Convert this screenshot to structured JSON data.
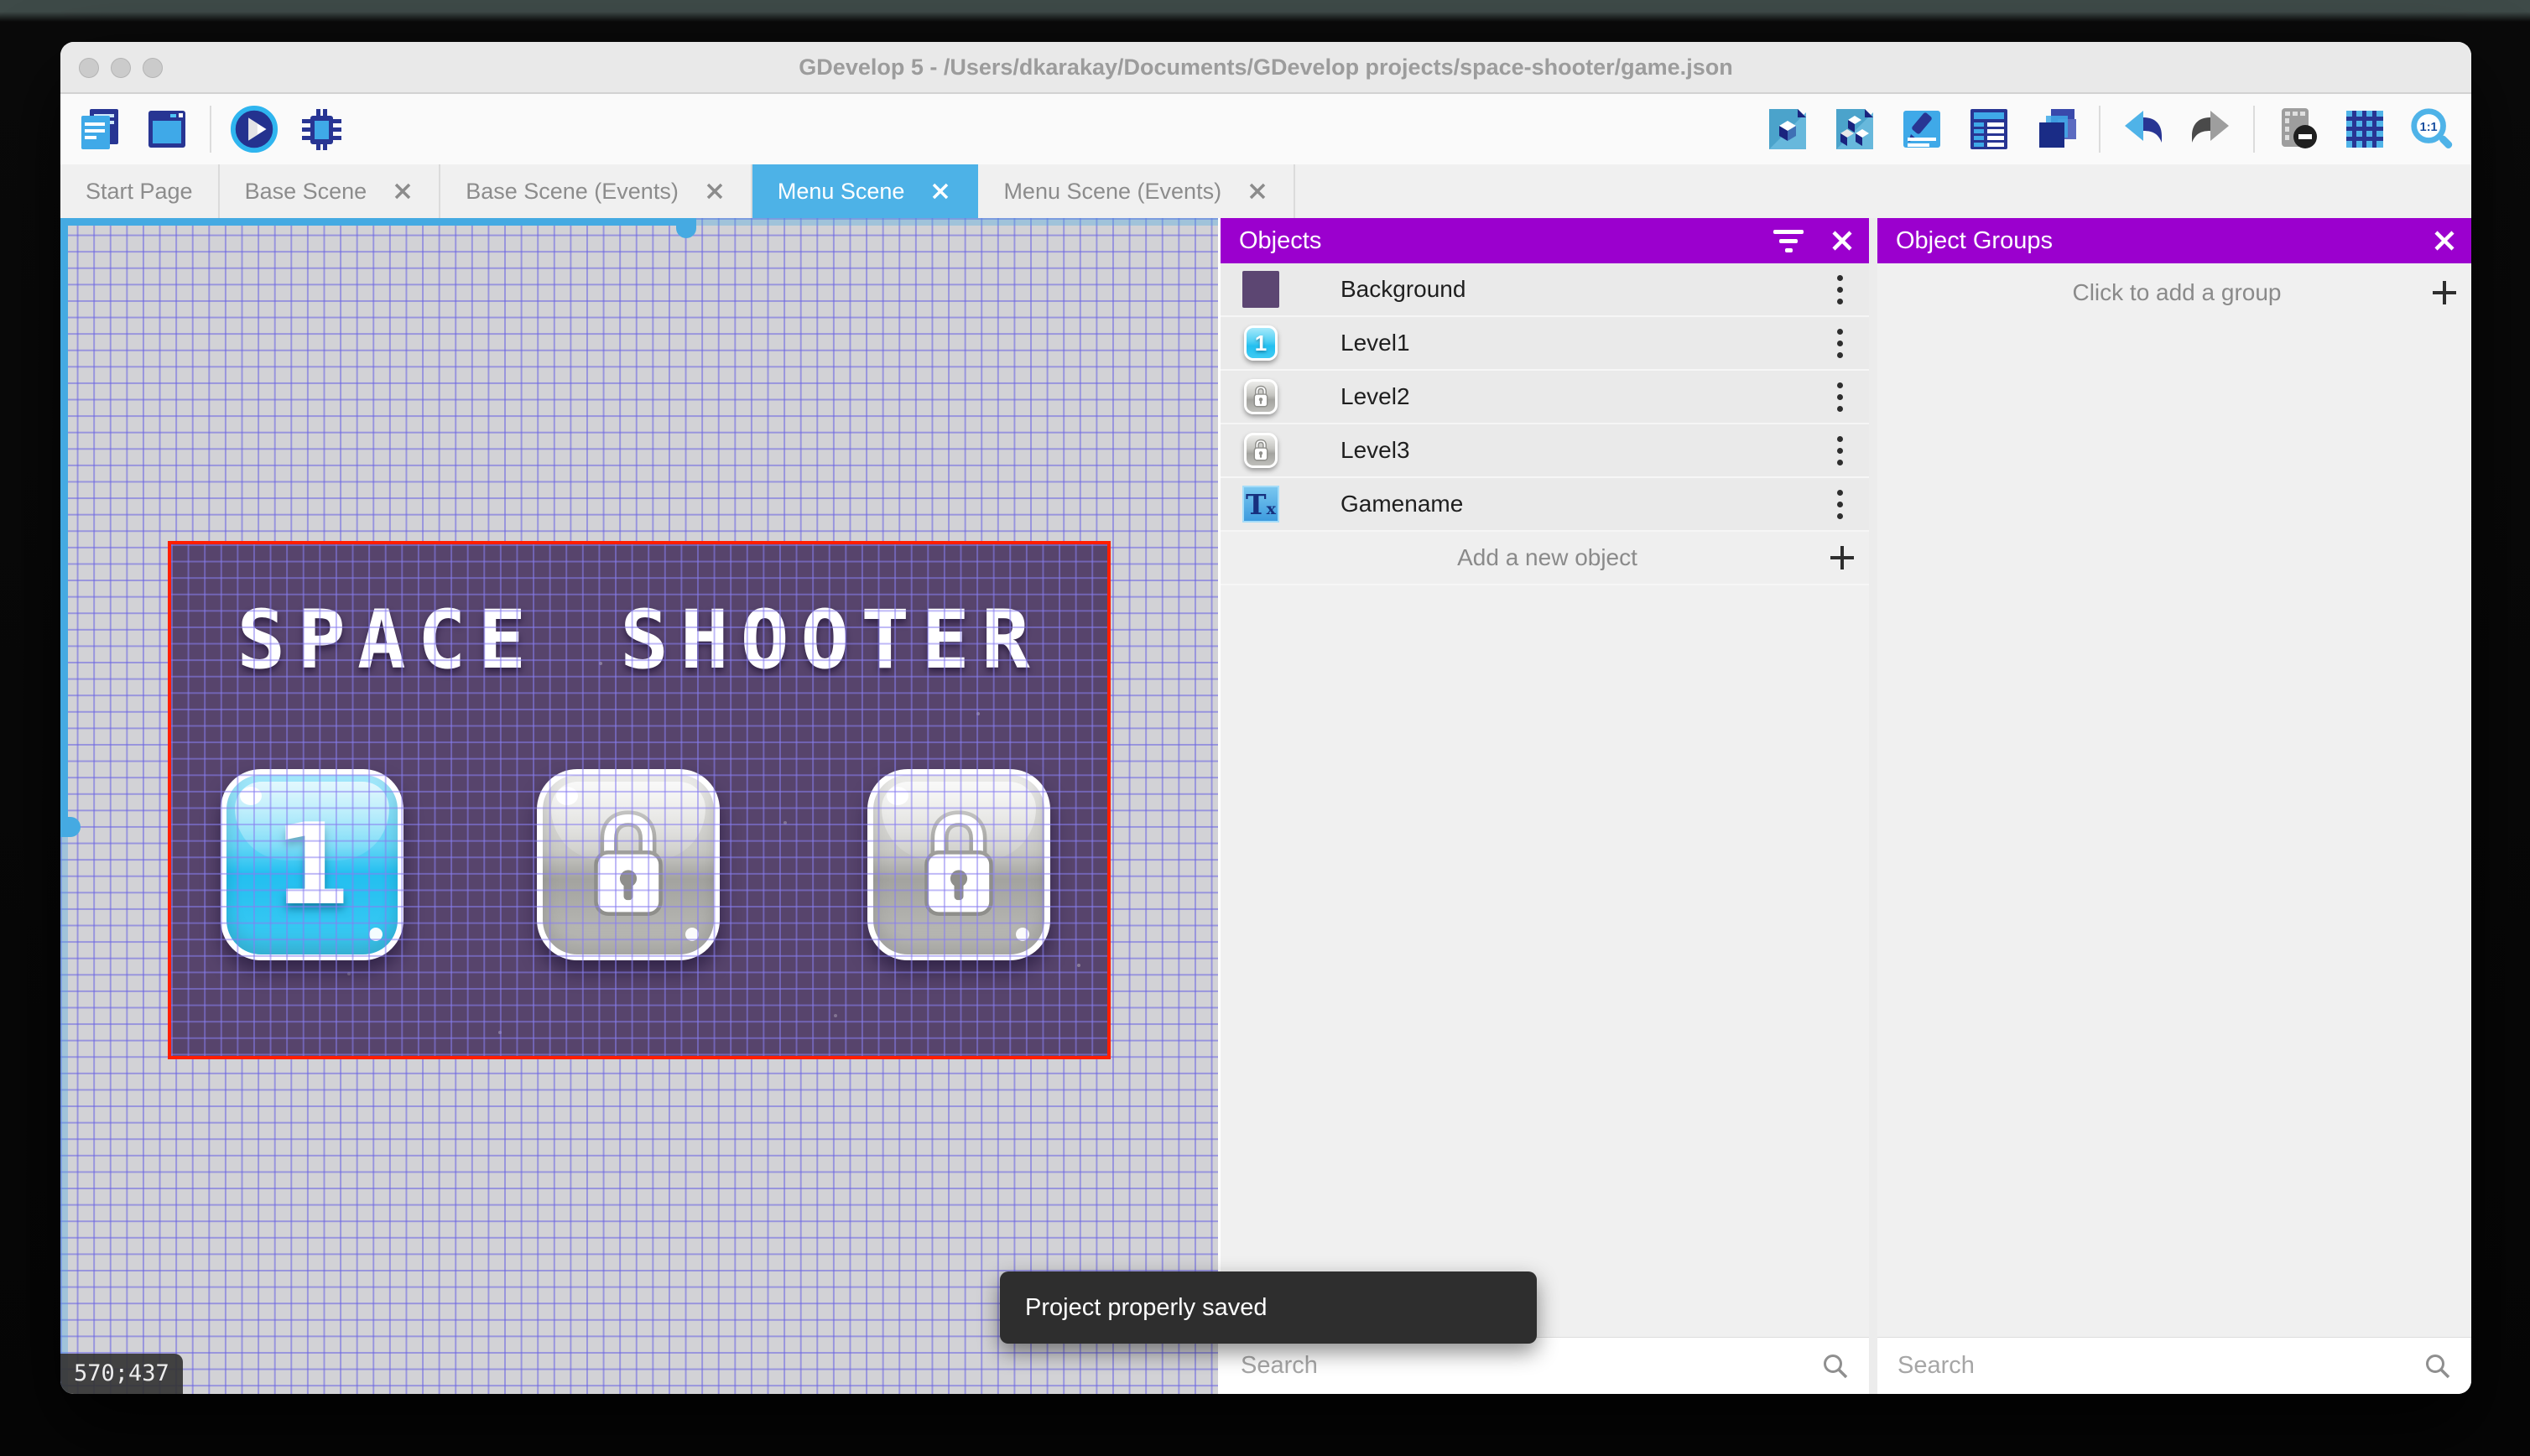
{
  "window": {
    "title": "GDevelop 5 - /Users/dkarakay/Documents/GDevelop projects/space-shooter/game.json",
    "traffic_lights": [
      "close",
      "minimize",
      "maximize"
    ]
  },
  "toolbar": {
    "left_icons": [
      "project-manager",
      "scene-editor-window",
      "preview-play",
      "debugger-bug"
    ],
    "right_icons": [
      "objects-editor",
      "object-groups-editor",
      "properties-pencil",
      "instances-list",
      "layers",
      "undo",
      "redo",
      "mask-preview",
      "grid-toggle",
      "zoom-one-to-one"
    ],
    "zoom_label": "1:1"
  },
  "tabs": [
    {
      "label": "Start Page",
      "closable": false,
      "active": false
    },
    {
      "label": "Base Scene",
      "closable": true,
      "active": false
    },
    {
      "label": "Base Scene (Events)",
      "closable": true,
      "active": false
    },
    {
      "label": "Menu Scene",
      "closable": true,
      "active": true
    },
    {
      "label": "Menu Scene (Events)",
      "closable": true,
      "active": false
    }
  ],
  "canvas": {
    "coordinates": "570;437",
    "scene": {
      "title": "SPACE SHOOTER",
      "level_buttons": [
        {
          "label": "1",
          "state": "unlocked"
        },
        {
          "label": "",
          "state": "locked"
        },
        {
          "label": "",
          "state": "locked"
        }
      ]
    }
  },
  "toast": {
    "message": "Project properly saved"
  },
  "objects_panel": {
    "title": "Objects",
    "rows": [
      {
        "label": "Background",
        "icon": "background-swatch"
      },
      {
        "label": "Level1",
        "icon": "level-one-button",
        "icon_label": "1"
      },
      {
        "label": "Level2",
        "icon": "locked-button"
      },
      {
        "label": "Level3",
        "icon": "locked-button"
      },
      {
        "label": "Gamename",
        "icon": "text-object",
        "icon_label": "T",
        "icon_sub": "x"
      }
    ],
    "add_label": "Add a new object",
    "search_placeholder": "Search"
  },
  "object_groups_panel": {
    "title": "Object Groups",
    "empty_label": "Click to add a group",
    "search_placeholder": "Search"
  },
  "colors": {
    "accent_purple": "#9B00CE",
    "active_tab_blue": "#4DB2E7",
    "scene_background": "#57446C",
    "selection_red": "#FF1E00",
    "grid_line_blue": "#6862E2",
    "toast_dark": "#2E2E2E"
  }
}
